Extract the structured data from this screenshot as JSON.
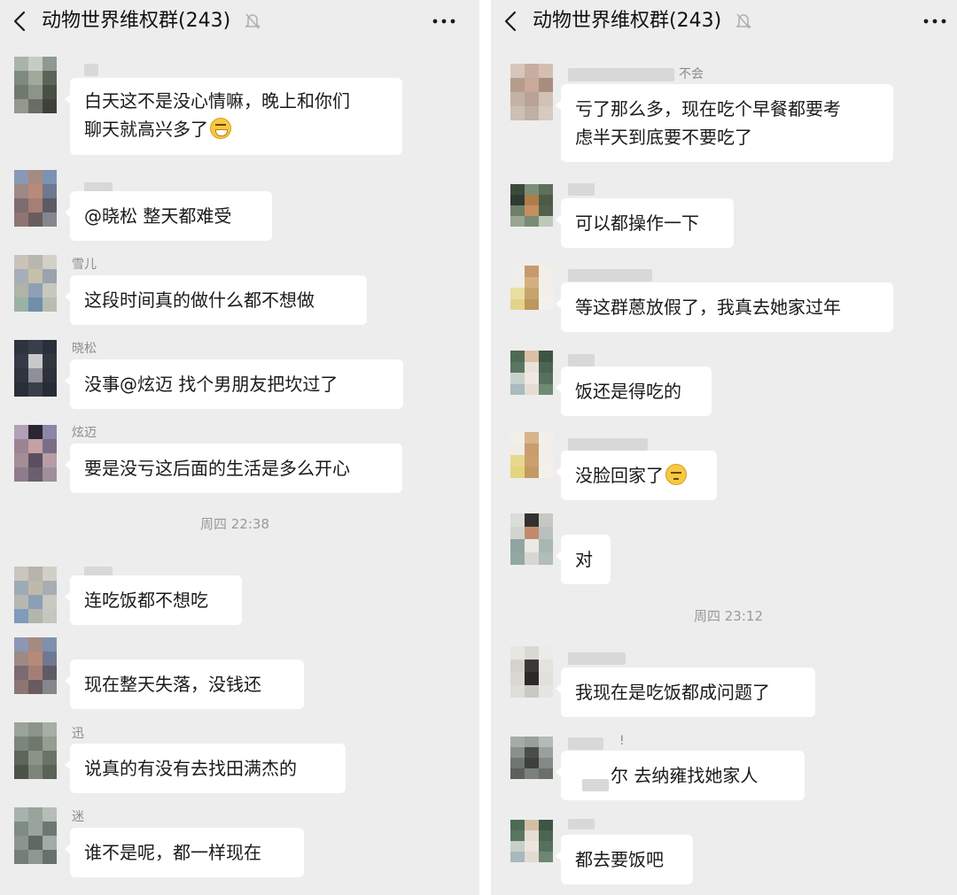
{
  "left": {
    "title": "动物世界维权群(243)",
    "messages": [
      {
        "sender": "",
        "lines": [
          "白天这不是没心情嘛，晚上和你们",
          "聊天就高兴多了"
        ],
        "emoji": "grinning-face-icon"
      },
      {
        "sender": "",
        "lines": [
          "@晓松  整天都难受"
        ]
      },
      {
        "sender": "雪儿",
        "lines": [
          "这段时间真的做什么都不想做"
        ]
      },
      {
        "sender": "晓松",
        "lines": [
          "没事@炫迈  找个男朋友把坎过了"
        ]
      },
      {
        "sender": "炫迈",
        "lines": [
          "要是没亏这后面的生活是多么开心"
        ]
      },
      {
        "sender": "",
        "lines": [
          "连吃饭都不想吃"
        ]
      },
      {
        "sender": "",
        "lines": [
          "现在整天失落，没钱还"
        ]
      },
      {
        "sender": "迅",
        "lines": [
          "说真的有没有去找田满杰的"
        ]
      },
      {
        "sender": "迷",
        "lines": [
          "谁不是呢，都一样现在"
        ]
      }
    ],
    "timestamp": "周四 22:38"
  },
  "right": {
    "title": "动物世界维权群(243)",
    "messages": [
      {
        "sender": "不会",
        "lines": [
          "亏了那么多，现在吃个早餐都要考",
          "虑半天到底要不要吃了"
        ]
      },
      {
        "sender": "",
        "lines": [
          "可以都操作一下"
        ]
      },
      {
        "sender": "",
        "lines": [
          "等这群蒽放假了，我真去她家过年"
        ]
      },
      {
        "sender": "",
        "lines": [
          "饭还是得吃的"
        ]
      },
      {
        "sender": "",
        "lines": [
          "没脸回家了"
        ],
        "emoji": "pensive-face-icon"
      },
      {
        "sender": "",
        "lines": [
          "对"
        ]
      },
      {
        "sender": "",
        "lines": [
          "我现在是吃饭都成问题了"
        ]
      },
      {
        "sender": "!",
        "lines": [
          "尔  去纳雍找她家人"
        ]
      },
      {
        "sender": "",
        "lines": [
          "都去要饭吧"
        ]
      }
    ],
    "timestamp": "周四 23:12"
  }
}
